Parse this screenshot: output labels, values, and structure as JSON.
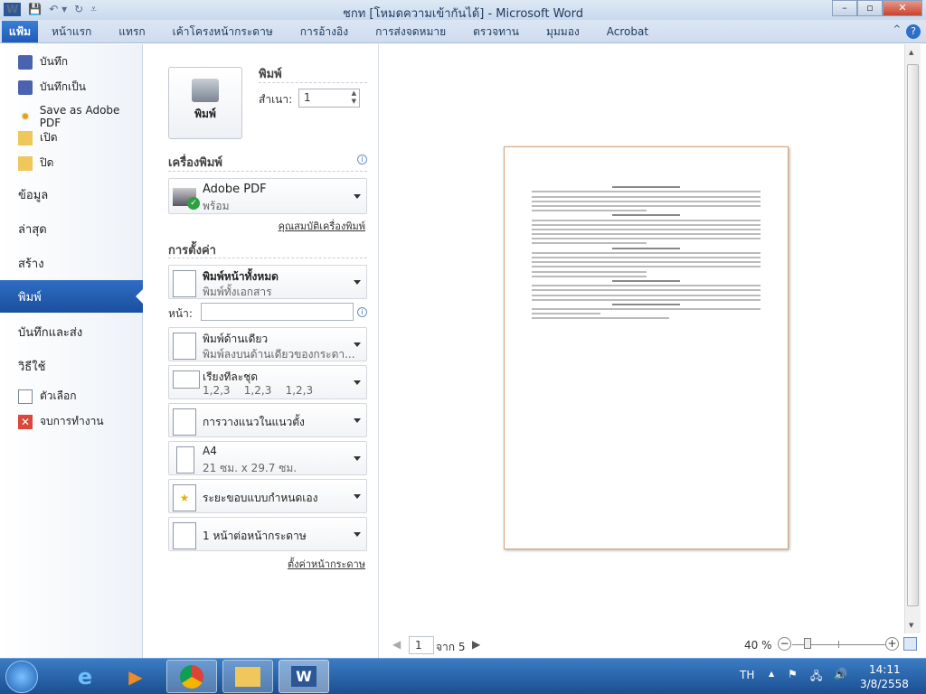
{
  "window": {
    "title": "ชกท [โหมดความเข้ากันได้] - Microsoft Word",
    "app_icon": "W",
    "minimize": "–",
    "maximize": "▫",
    "close": "✕"
  },
  "ribbon": {
    "tabs": [
      "แฟ้ม",
      "หน้าแรก",
      "แทรก",
      "เค้าโครงหน้ากระดาษ",
      "การอ้างอิง",
      "การส่งจดหมาย",
      "ตรวจทาน",
      "มุมมอง",
      "Acrobat"
    ],
    "help": "?",
    "minimize_ribbon": "^"
  },
  "sidebar": {
    "items": [
      {
        "label": "บันทึก",
        "icon": "save-icon"
      },
      {
        "label": "บันทึกเป็น",
        "icon": "save-as-icon"
      },
      {
        "label": "Save as Adobe PDF",
        "icon": "pdf-icon"
      },
      {
        "label": "เปิด",
        "icon": "open-folder-icon"
      },
      {
        "label": "ปิด",
        "icon": "close-folder-icon"
      }
    ],
    "sections": [
      "ข้อมูล",
      "ล่าสุด",
      "สร้าง",
      "พิมพ์",
      "บันทึกและส่ง",
      "วิธีใช้"
    ],
    "active": "พิมพ์",
    "bottom": [
      {
        "label": "ตัวเลือก",
        "icon": "options-icon"
      },
      {
        "label": "จบการทำงาน",
        "icon": "exit-icon"
      }
    ]
  },
  "print": {
    "button": "พิมพ์",
    "header": "พิมพ์",
    "copies_label": "สำเนา:",
    "copies_value": "1"
  },
  "printer": {
    "header": "เครื่องพิมพ์",
    "name": "Adobe PDF",
    "status": "พร้อม",
    "properties_link": "คุณสมบัติเครื่องพิมพ์"
  },
  "settings": {
    "header": "การตั้งค่า",
    "pages_label": "หน้า:",
    "pages_value": "",
    "options": [
      {
        "title": "พิมพ์หน้าทั้งหมด",
        "subtitle": "พิมพ์ทั้งเอกสาร"
      },
      {
        "title": "พิมพ์ด้านเดียว",
        "subtitle": "พิมพ์ลงบนด้านเดียวของกระดา..."
      },
      {
        "title": "เรียงทีละชุด",
        "subtitle": "1,2,3    1,2,3    1,2,3"
      },
      {
        "title": "การวางแนวในแนวตั้ง",
        "subtitle": ""
      },
      {
        "title": "A4",
        "subtitle": "21 ซม. x 29.7 ซม."
      },
      {
        "title": "ระยะขอบแบบกำหนดเอง",
        "subtitle": ""
      },
      {
        "title": "1 หน้าต่อหน้ากระดาษ",
        "subtitle": ""
      }
    ],
    "page_setup_link": "ตั้งค่าหน้ากระดาษ"
  },
  "preview": {
    "current_page": "1",
    "of_label": "จาก 5",
    "zoom": "40 %",
    "zoom_level_percent": 40
  },
  "taskbar": {
    "language": "TH",
    "time": "14:11",
    "date": "3/8/2558",
    "apps": [
      "internet-explorer",
      "media-player",
      "chrome",
      "explorer",
      "word"
    ]
  }
}
